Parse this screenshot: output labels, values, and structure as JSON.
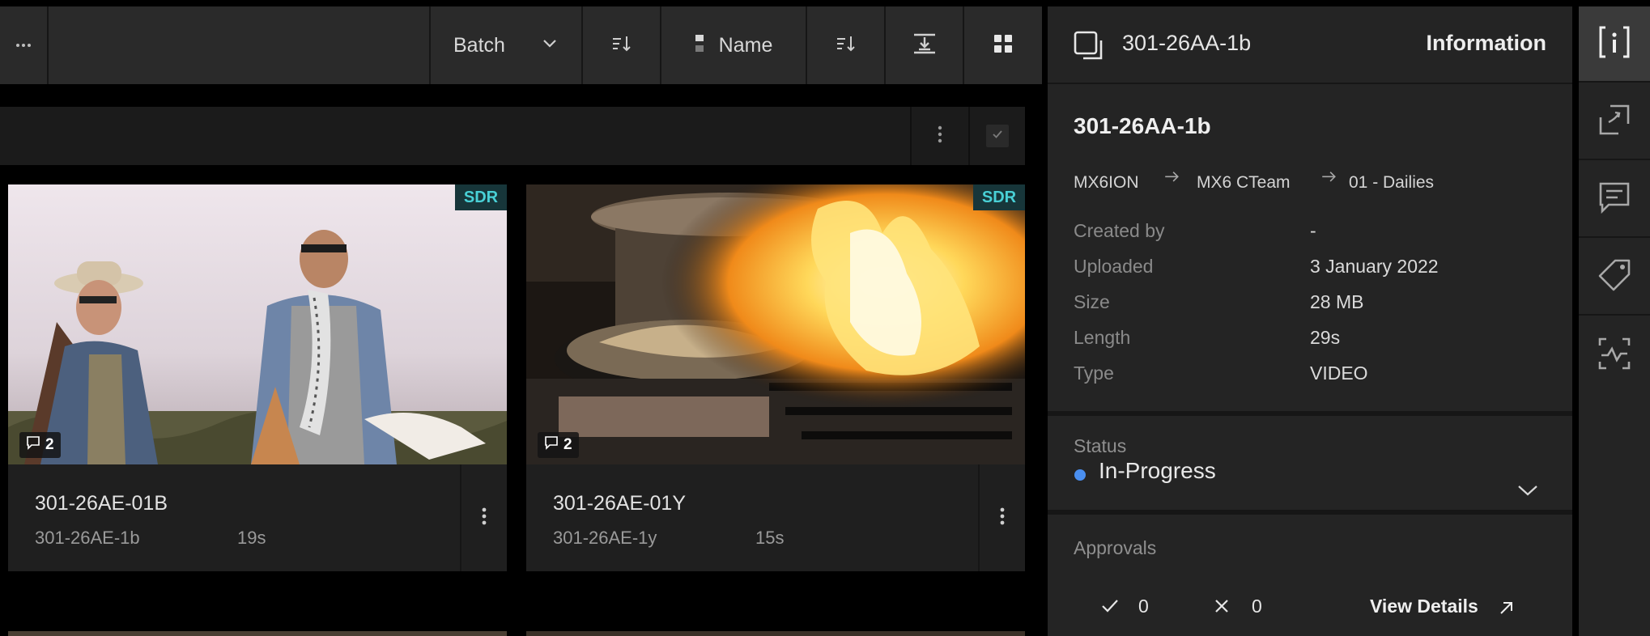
{
  "toolbar": {
    "group_by": "Batch",
    "sort_field": "Name"
  },
  "cards": [
    {
      "badge": "SDR",
      "comments": "2",
      "title": "301-26AE-01B",
      "subtitle": "301-26AE-1b",
      "duration": "19s"
    },
    {
      "badge": "SDR",
      "comments": "2",
      "title": "301-26AE-01Y",
      "subtitle": "301-26AE-1y",
      "duration": "15s"
    }
  ],
  "panel": {
    "header_title": "301-26AA-1b",
    "header_tab": "Information",
    "asset_name": "301-26AA-1b",
    "breadcrumb": [
      "MX6ION",
      "MX6 CTeam",
      "01 - Dailies"
    ],
    "properties": [
      {
        "label": "Created by",
        "value": "-"
      },
      {
        "label": "Uploaded",
        "value": "3 January 2022"
      },
      {
        "label": "Size",
        "value": "28 MB"
      },
      {
        "label": "Length",
        "value": "29s"
      },
      {
        "label": "Type",
        "value": "VIDEO"
      }
    ],
    "status_label": "Status",
    "status_value": "In-Progress",
    "status_color": "#4a8ff0",
    "approvals_label": "Approvals",
    "approved_count": "0",
    "rejected_count": "0",
    "view_details": "View Details"
  },
  "colors": {
    "accent_sdr": "#49d0d6",
    "background": "#000000",
    "panel": "#242424"
  }
}
